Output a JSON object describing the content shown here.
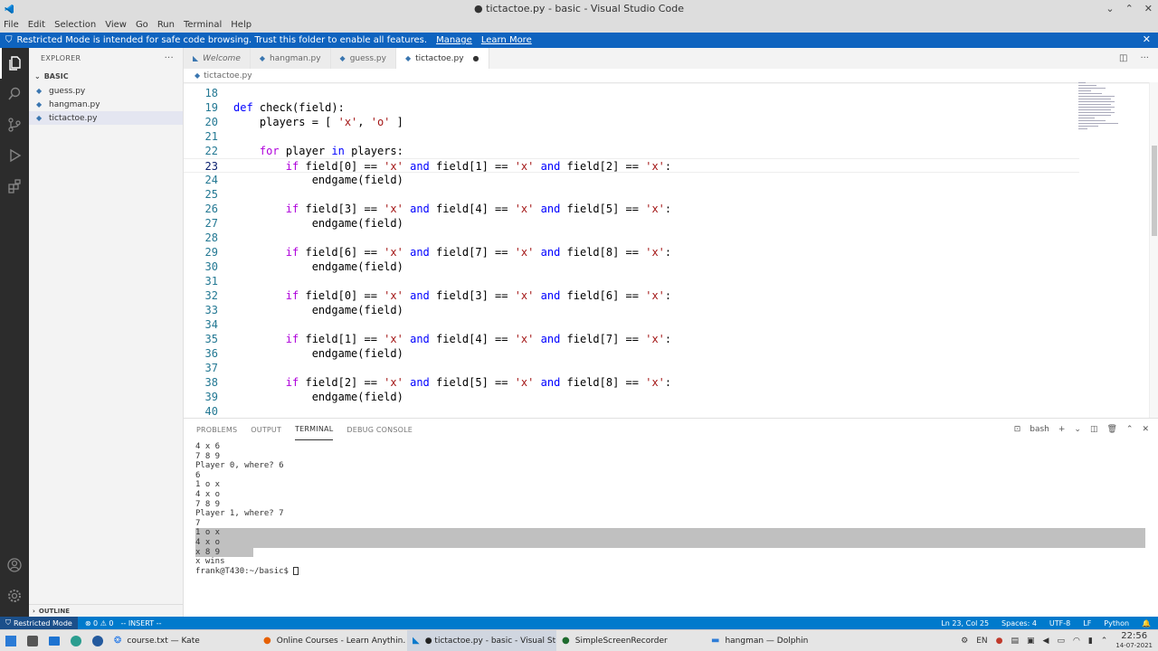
{
  "window": {
    "title": "● tictactoe.py - basic - Visual Studio Code",
    "controls": [
      "⌄",
      "⌃",
      "✕"
    ]
  },
  "menu": [
    "File",
    "Edit",
    "Selection",
    "View",
    "Go",
    "Run",
    "Terminal",
    "Help"
  ],
  "banner": {
    "text": "Restricted Mode is intended for safe code browsing. Trust this folder to enable all features.",
    "manage": "Manage",
    "learn_more": "Learn More"
  },
  "explorer": {
    "title": "EXPLORER",
    "folder": "BASIC",
    "files": [
      "guess.py",
      "hangman.py",
      "tictactoe.py"
    ],
    "outline": "OUTLINE"
  },
  "tabs": [
    {
      "label": "Welcome"
    },
    {
      "label": "hangman.py"
    },
    {
      "label": "guess.py"
    },
    {
      "label": "tictactoe.py"
    }
  ],
  "breadcrumb": "tictactoe.py",
  "editor": {
    "lines": [
      {
        "n": "18"
      },
      {
        "n": "19"
      },
      {
        "n": "20"
      },
      {
        "n": "21"
      },
      {
        "n": "22"
      },
      {
        "n": "23"
      },
      {
        "n": "24"
      },
      {
        "n": "25"
      },
      {
        "n": "26"
      },
      {
        "n": "27"
      },
      {
        "n": "28"
      },
      {
        "n": "29"
      },
      {
        "n": "30"
      },
      {
        "n": "31"
      },
      {
        "n": "32"
      },
      {
        "n": "33"
      },
      {
        "n": "34"
      },
      {
        "n": "35"
      },
      {
        "n": "36"
      },
      {
        "n": "37"
      },
      {
        "n": "38"
      },
      {
        "n": "39"
      },
      {
        "n": "40"
      }
    ]
  },
  "panel": {
    "tabs": [
      "PROBLEMS",
      "OUTPUT",
      "TERMINAL",
      "DEBUG CONSOLE"
    ],
    "shell": "bash",
    "terminal_lines": [
      "4 x 6",
      "7 8 9",
      "",
      "",
      "Player 0, where? 6",
      "6",
      "1 o x",
      "4 x o",
      "7 8 9",
      "",
      "",
      "Player 1, where? 7",
      "7",
      "1 o x",
      "4 x o",
      "x 8 9",
      "x wins"
    ],
    "prompt": "frank@T430:~/basic$ "
  },
  "status": {
    "restricted": "Restricted Mode",
    "problems": "⊗ 0 ⚠ 0",
    "mode": "-- INSERT --",
    "position": "Ln 23, Col 25",
    "spaces": "Spaces: 4",
    "encoding": "UTF-8",
    "eol": "LF",
    "language": "Python"
  },
  "taskbar": {
    "tasks": [
      {
        "label": "course.txt — Kate"
      },
      {
        "label": "Online Courses - Learn Anythin..."
      },
      {
        "label": "● tictactoe.py - basic - Visual St..."
      },
      {
        "label": "SimpleScreenRecorder"
      },
      {
        "label": "hangman — Dolphin"
      }
    ],
    "lang": "EN",
    "time": "22:56",
    "date": "14-07-2021"
  }
}
